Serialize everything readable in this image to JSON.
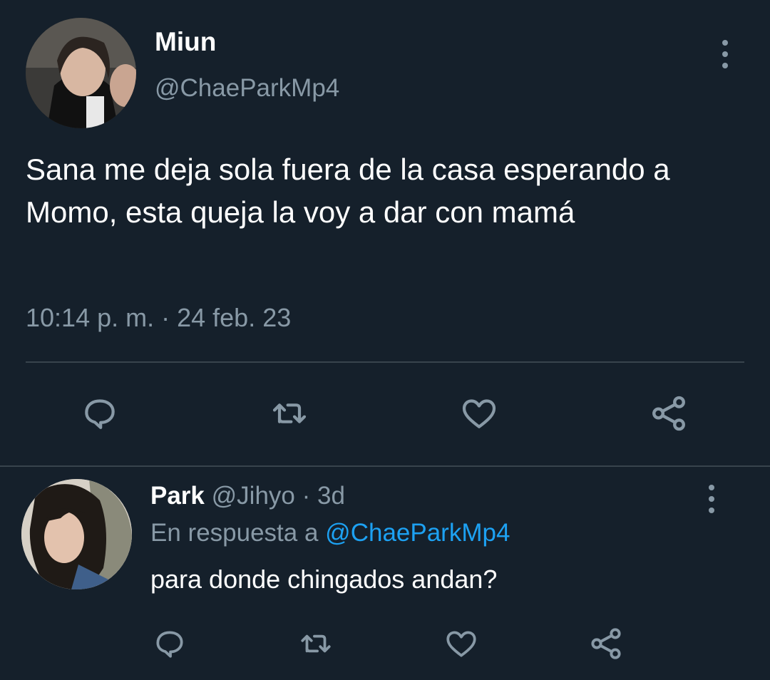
{
  "tweet": {
    "display_name": "Miun",
    "handle": "@ChaeParkMp4",
    "text": "Sana me deja sola fuera de la casa esperando a Momo, esta queja la voy a dar con mamá",
    "timestamp": "10:14 p. m. · 24 feb. 23",
    "icons": [
      "reply-icon",
      "retweet-icon",
      "like-icon",
      "share-icon",
      "more-icon"
    ]
  },
  "reply": {
    "display_name": "Park",
    "handle": "@Jihyo",
    "age": "3d",
    "in_reply_prefix": "En respuesta a",
    "in_reply_mention": "@ChaeParkMp4",
    "text": "para donde chingados andan?"
  },
  "colors": {
    "background": "#15202b",
    "secondary_text": "#8899a6",
    "link": "#1da1f2",
    "divider": "#38444d"
  }
}
